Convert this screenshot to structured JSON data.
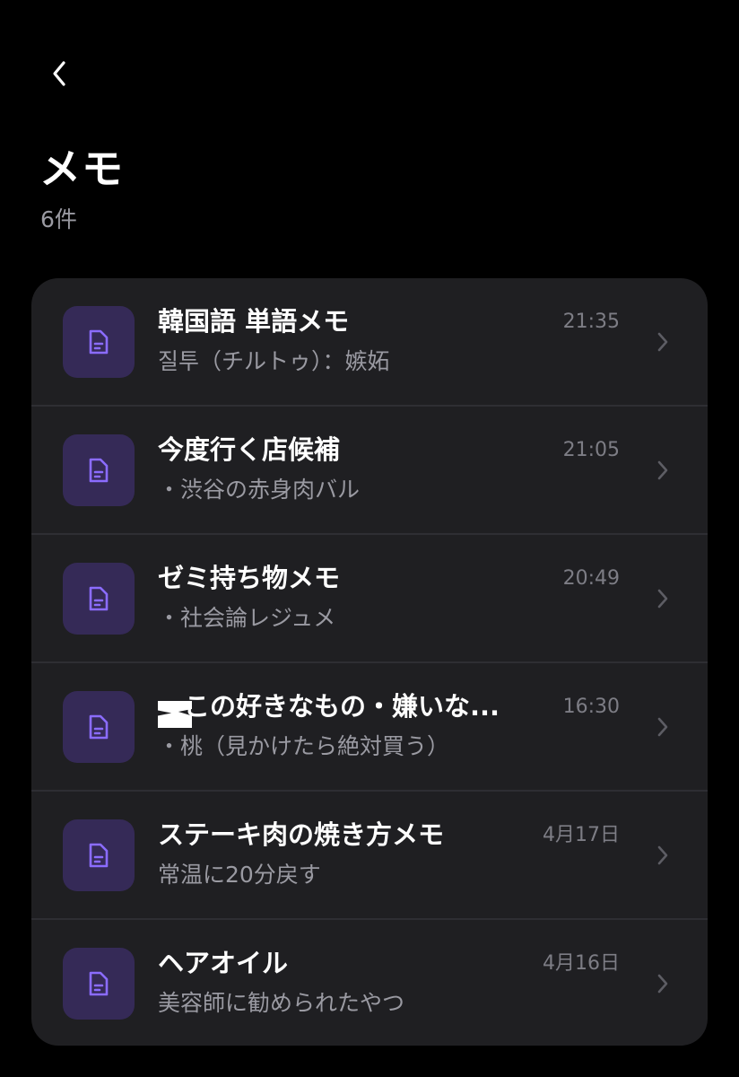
{
  "header": {
    "back_icon": "chevron-left-icon",
    "title": "メモ",
    "count": "6件"
  },
  "colors": {
    "background": "#000000",
    "card": "#1f1f22",
    "icon_bg": "#352a57",
    "icon_fg": "#8b6cff",
    "secondary_text": "#9a9aa2"
  },
  "memos": [
    {
      "title": "韓国語 単語メモ",
      "preview": "질투（チルトゥ）：嫉妬",
      "time": "21:35",
      "icon": "document-icon"
    },
    {
      "title": "今度行く店候補",
      "preview": "・渋谷の赤身肉バル",
      "time": "21:05",
      "icon": "document-icon"
    },
    {
      "title": "ゼミ持ち物メモ",
      "preview": "・社会論レジュメ",
      "time": "20:49",
      "icon": "document-icon"
    },
    {
      "title": "　この好きなもの・嫌いな...",
      "preview": "・桃（見かけたら絶対買う）",
      "time": "16:30",
      "icon": "document-icon"
    },
    {
      "title": "ステーキ肉の焼き方メモ",
      "preview": "常温に20分戻す",
      "time": "4月17日",
      "icon": "document-icon"
    },
    {
      "title": "ヘアオイル",
      "preview": "美容師に勧められたやつ",
      "time": "4月16日",
      "icon": "document-icon"
    }
  ]
}
